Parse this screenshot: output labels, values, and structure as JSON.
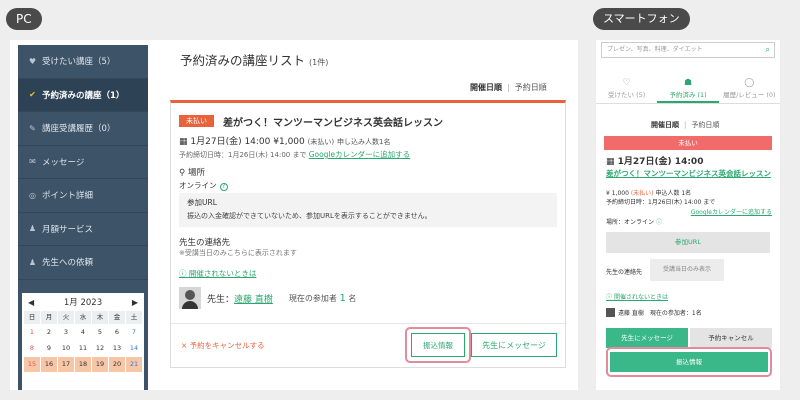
{
  "labels": {
    "pc": "PC",
    "smartphone": "スマートフォン"
  },
  "sidebar": {
    "items": [
      {
        "icon": "heart-icon",
        "glyph": "♥",
        "label": "受けたい講座（5）"
      },
      {
        "icon": "check-icon",
        "glyph": "✔",
        "label": "予約済みの講座（1）"
      },
      {
        "icon": "pencil-icon",
        "glyph": "✎",
        "label": "講座受講履歴（0）"
      },
      {
        "icon": "mail-icon",
        "glyph": "✉",
        "label": "メッセージ"
      },
      {
        "icon": "coin-icon",
        "glyph": "◎",
        "label": "ポイント詳細"
      },
      {
        "icon": "people-icon",
        "glyph": "♟",
        "label": "月額サービス"
      },
      {
        "icon": "people-icon",
        "glyph": "♟",
        "label": "先生への依頼"
      }
    ]
  },
  "calendar": {
    "month": "1月 2023",
    "weekdays": [
      "日",
      "月",
      "火",
      "水",
      "木",
      "金",
      "土"
    ],
    "days": [
      "1",
      "2",
      "3",
      "4",
      "5",
      "6",
      "7",
      "8",
      "9",
      "10",
      "11",
      "12",
      "13",
      "14",
      "15",
      "16",
      "17",
      "18",
      "19",
      "20",
      "21"
    ]
  },
  "pc": {
    "page_title": "予約済みの講座リスト",
    "count": "(1件)",
    "sort_active": "開催日順",
    "sort_other": "予約日順",
    "card": {
      "badge": "未払い",
      "title": "差がつく！マンツーマンビジネス英会話レッスン",
      "date": "1月27日(金) 14:00",
      "price": "¥1,000",
      "unpaid": "(未払い)",
      "applicants": "申し込み人数1名",
      "deadline": "予約締切日時：1月26日(木) 14:00 まで",
      "gcal": "Googleカレンダーに追加する",
      "place_heading": "場所",
      "place_value": "オンライン",
      "url_heading": "参加URL",
      "url_text": "振込の入金確認ができていないため、参加URLを表示することができません。",
      "contact_heading": "先生の連絡先",
      "contact_note": "※受講当日のみこちらに表示されます",
      "not_held": "開催されないときは",
      "teacher_prefix": "先生：",
      "teacher_name": "遠藤 直樹",
      "participants_label": "現在の参加者",
      "participants_count": "1",
      "participants_unit": "名",
      "cancel": "× 予約をキャンセルする",
      "transfer": "振込情報",
      "message": "先生にメッセージ"
    }
  },
  "sp": {
    "search_placeholder": "プレゼン、写真、料理、ダイエット",
    "tabs": [
      {
        "icon": "heart-icon",
        "glyph": "♡",
        "label": "受けたい (5)"
      },
      {
        "icon": "calendar-icon",
        "glyph": "☗",
        "label": "予約済み (1)"
      },
      {
        "icon": "chat-icon",
        "glyph": "◯",
        "label": "履歴/レビュー (0)"
      }
    ],
    "sort_active": "開催日順",
    "sort_other": "予約日順",
    "badge": "未払い",
    "date": "1月27日(金) 14:00",
    "title": "差がつく！マンツーマンビジネス英会話レッスン",
    "price": "¥ 1,000",
    "unpaid": "(未払い)",
    "applicants": "申込人数 1名",
    "deadline": "予約締切日時：1月26日(木) 14:00 まで",
    "gcal": "Googleカレンダーに追加する",
    "place": "場所：オンライン",
    "url_button": "参加URL",
    "contact_label": "先生の連絡先",
    "contact_value": "受講当日のみ表示",
    "not_held": "開催されないときは",
    "teacher": "遠藤 直樹　現在の参加者：1名",
    "message_button": "先生にメッセージ",
    "cancel_button": "予約キャンセル",
    "transfer_button": "振込情報"
  },
  "colors": {
    "accent_green": "#2aa86f",
    "badge_red": "#e8633c",
    "sidebar": "#3d5368",
    "highlight_ring": "#e38b9a"
  }
}
